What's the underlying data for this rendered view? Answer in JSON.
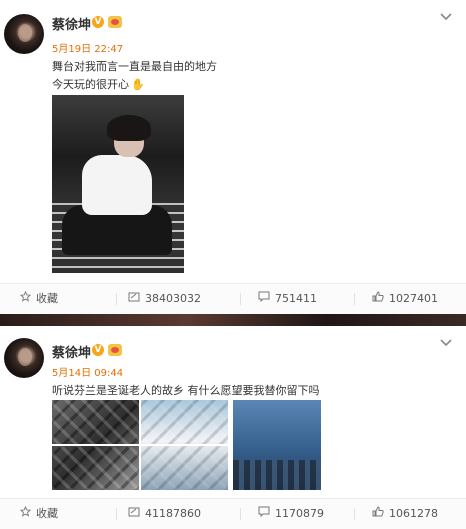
{
  "posts": [
    {
      "author": "蔡徐坤",
      "verified_badge": "V",
      "time": "5月19日 22:47",
      "text_lines": [
        "舞台对我而言一直是最自由的地方",
        "今天玩的很开心"
      ],
      "emoji": "wave-hand-emoji",
      "actions": {
        "favorite_label": "收藏",
        "repost_count": "38403032",
        "comment_count": "751411",
        "like_count": "1027401"
      }
    },
    {
      "author": "蔡徐坤",
      "verified_badge": "V",
      "time": "5月14日 09:44",
      "text_lines": [
        "听说芬兰是圣诞老人的故乡 有什么愿望要我替你留下吗"
      ],
      "actions": {
        "favorite_label": "收藏",
        "repost_count": "41187860",
        "comment_count": "1170879",
        "like_count": "1061278"
      }
    }
  ],
  "colors": {
    "time_orange": "#e66f00",
    "verified_orange": "#f8a51a",
    "text": "#333333",
    "action_text": "#555555"
  },
  "icons": [
    "chevron-down-icon",
    "star-icon",
    "repost-icon",
    "comment-icon",
    "like-icon"
  ]
}
